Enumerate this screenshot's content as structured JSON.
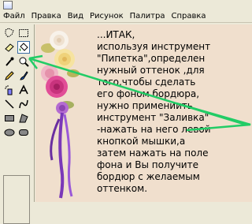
{
  "menu": {
    "items": [
      "Файл",
      "Правка",
      "Вид",
      "Рисунок",
      "Палитра",
      "Справка"
    ]
  },
  "tools": [
    {
      "name": "free-select-icon"
    },
    {
      "name": "rect-select-icon"
    },
    {
      "name": "eraser-icon"
    },
    {
      "name": "fill-bucket-icon"
    },
    {
      "name": "eyedropper-icon"
    },
    {
      "name": "magnifier-icon"
    },
    {
      "name": "pencil-icon"
    },
    {
      "name": "brush-icon"
    },
    {
      "name": "airbrush-icon"
    },
    {
      "name": "text-icon"
    },
    {
      "name": "line-icon"
    },
    {
      "name": "curve-icon"
    },
    {
      "name": "rectangle-icon"
    },
    {
      "name": "polygon-icon"
    },
    {
      "name": "ellipse-icon"
    },
    {
      "name": "rounded-rect-icon"
    }
  ],
  "active_tool": "fill-bucket-icon",
  "canvas": {
    "background_color": "#f0dfcd",
    "annotation_color": "#22cc66",
    "text_lines": [
      "...ИТАК,",
      "используя инструмент",
      "\"Пипетка\",определен",
      "нужный оттенок ,для",
      "того,чтобы сделать",
      "его фоном бордюра,",
      "нужно примениить",
      "инструмент \"Заливка\"",
      "-нажать на него левой",
      "кнопкой мышки,а",
      "затем нажать на поле",
      "фона и Вы получите",
      "бордюр с желаемым",
      "оттенком."
    ]
  }
}
